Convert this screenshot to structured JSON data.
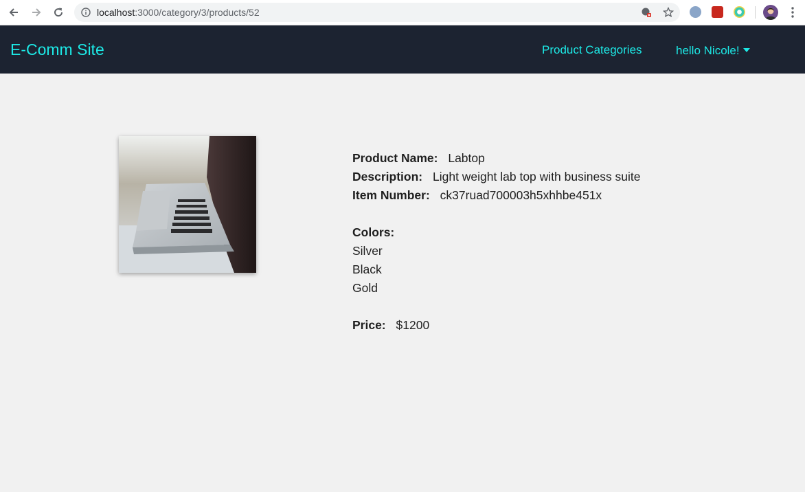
{
  "browser": {
    "url_host": "localhost",
    "url_path": ":3000/category/3/products/52"
  },
  "header": {
    "brand": "E-Comm Site",
    "nav_categories": "Product Categories",
    "nav_user": "hello Nicole!",
    "background": "#1c2331",
    "accent": "#1de9e6"
  },
  "product": {
    "image_icon": "laptop-photo",
    "name_label": "Product Name:",
    "name": "Labtop",
    "description_label": "Description:",
    "description": "Light weight lab top with business suite",
    "item_number_label": "Item Number:",
    "item_number": "ck37ruad700003h5xhhbe451x",
    "colors_label": "Colors:",
    "colors": [
      "Silver",
      "Black",
      "Gold"
    ],
    "price_label": "Price:",
    "price": "$1200"
  }
}
